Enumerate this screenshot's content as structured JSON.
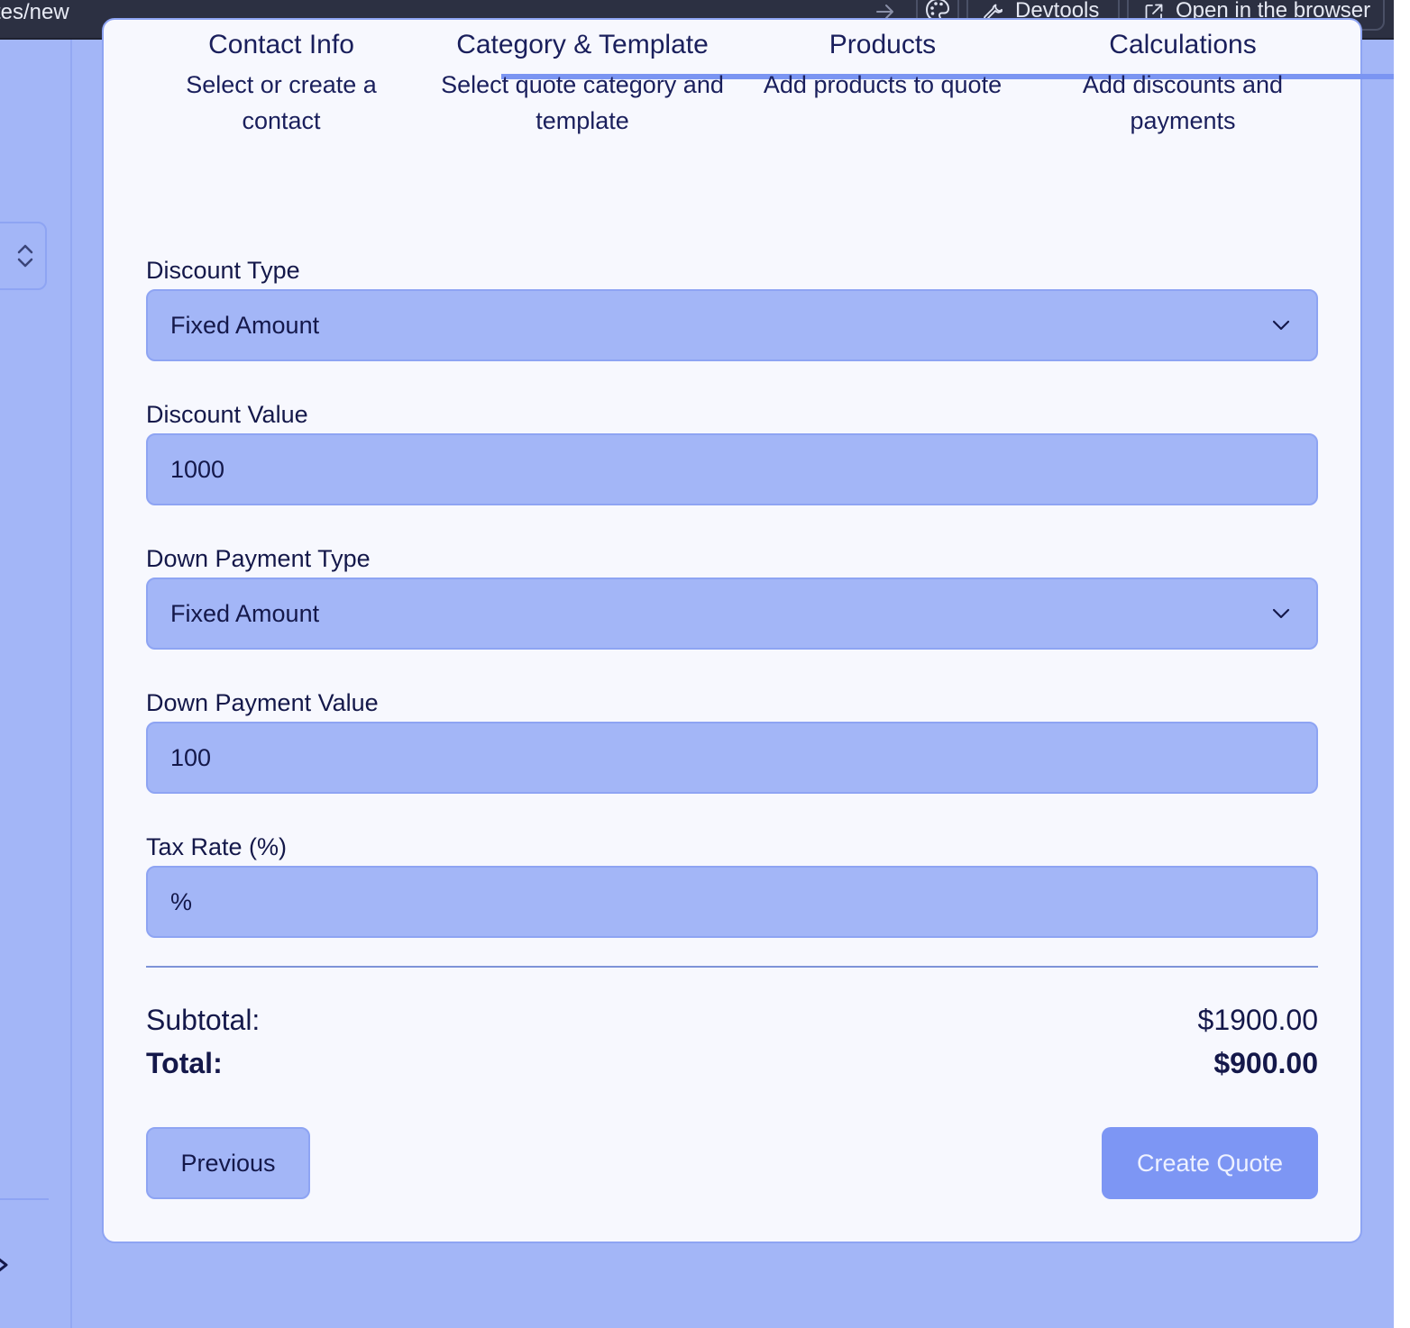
{
  "browser": {
    "url_fragment": "tes/new",
    "devtools_label": "Devtools",
    "open_in_browser_label": "Open in the browser"
  },
  "stepper": {
    "steps": [
      {
        "title": "Contact Info",
        "description": "Select or create a contact"
      },
      {
        "title": "Category & Template",
        "description": "Select quote category and template"
      },
      {
        "title": "Products",
        "description": "Add products to quote"
      },
      {
        "title": "Calculations",
        "description": "Add discounts and payments"
      }
    ]
  },
  "form": {
    "discount_type": {
      "label": "Discount Type",
      "value": "Fixed Amount"
    },
    "discount_value": {
      "label": "Discount Value",
      "value": "1000"
    },
    "down_payment_type": {
      "label": "Down Payment Type",
      "value": "Fixed Amount"
    },
    "down_payment_value": {
      "label": "Down Payment Value",
      "value": "100"
    },
    "tax_rate": {
      "label": "Tax Rate (%)",
      "placeholder": "%"
    }
  },
  "summary": {
    "subtotal_label": "Subtotal:",
    "subtotal_value": "$1900.00",
    "total_label": "Total:",
    "total_value": "$900.00"
  },
  "actions": {
    "previous_label": "Previous",
    "create_label": "Create Quote"
  },
  "icons": {
    "palette": "palette-icon",
    "devtools": "wrench-icon",
    "open_external": "external-link-icon",
    "go": "arrow-right-icon",
    "collapse": "chevron-up-down-icon",
    "select": "chevron-down-icon"
  },
  "colors": {
    "app_background": "#a3b6f7",
    "card_background": "#f7f8fe",
    "input_background": "#a3b6f7",
    "primary_button": "#7d96f4",
    "text_dark": "#14184a",
    "toolbar": "#2c3042"
  }
}
